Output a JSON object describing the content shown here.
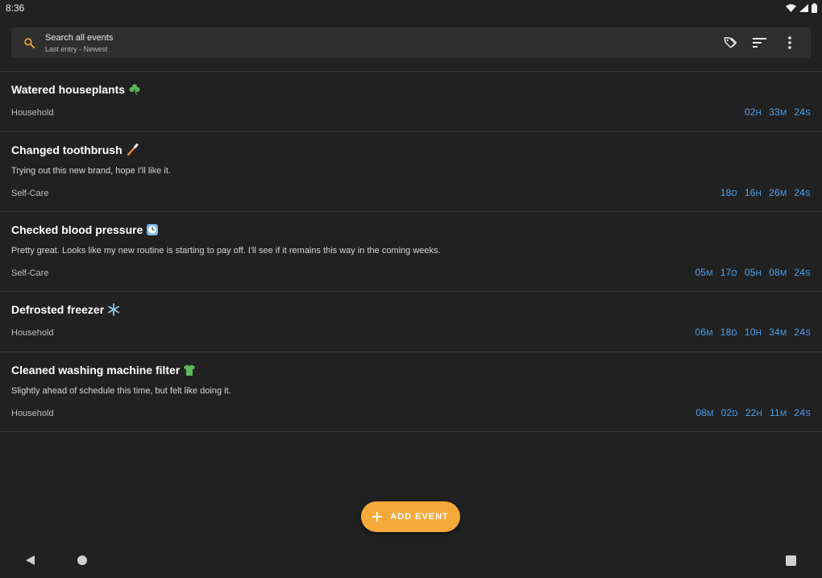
{
  "status_bar": {
    "time": "8:36",
    "icons": [
      "wifi-icon",
      "cellular-icon",
      "battery-icon"
    ]
  },
  "search": {
    "placeholder": "Search all events",
    "sort_label": "Last entry - Newest",
    "actions": [
      "tags-icon",
      "sort-icon",
      "more-vert-icon"
    ]
  },
  "colors": {
    "background": "#212121",
    "accent": "#f6a93b",
    "elapsed": "#4aa3f0"
  },
  "events": [
    {
      "title": "Watered houseplants",
      "emoji": "shamrock-icon",
      "note": "",
      "category": "Household",
      "elapsed": [
        [
          "02",
          "H"
        ],
        [
          "33",
          "M"
        ],
        [
          "24",
          "S"
        ]
      ]
    },
    {
      "title": "Changed toothbrush",
      "emoji": "toothbrush-icon",
      "note": "Trying out this new brand, hope I'll like it.",
      "category": "Self-Care",
      "elapsed": [
        [
          "18",
          "D"
        ],
        [
          "16",
          "H"
        ],
        [
          "26",
          "M"
        ],
        [
          "24",
          "S"
        ]
      ]
    },
    {
      "title": "Checked blood pressure",
      "emoji": "clock-icon",
      "note": "Pretty great. Looks like my new routine is starting to pay off. I'll see if it remains this way in the coming weeks.",
      "category": "Self-Care",
      "elapsed": [
        [
          "05",
          "M"
        ],
        [
          "17",
          "D"
        ],
        [
          "05",
          "H"
        ],
        [
          "08",
          "M"
        ],
        [
          "24",
          "S"
        ]
      ]
    },
    {
      "title": "Defrosted freezer",
      "emoji": "snowflake-icon",
      "note": "",
      "category": "Household",
      "elapsed": [
        [
          "06",
          "M"
        ],
        [
          "18",
          "D"
        ],
        [
          "10",
          "H"
        ],
        [
          "34",
          "M"
        ],
        [
          "24",
          "S"
        ]
      ]
    },
    {
      "title": "Cleaned washing machine filter",
      "emoji": "tshirt-icon",
      "note": "Slightly ahead of schedule this time, but felt like doing it.",
      "category": "Household",
      "elapsed": [
        [
          "08",
          "M"
        ],
        [
          "02",
          "D"
        ],
        [
          "22",
          "H"
        ],
        [
          "11",
          "M"
        ],
        [
          "24",
          "S"
        ]
      ]
    }
  ],
  "fab": {
    "label": "ADD EVENT",
    "icon": "plus-icon"
  },
  "nav": [
    "back-icon",
    "home-icon",
    "recents-icon"
  ]
}
